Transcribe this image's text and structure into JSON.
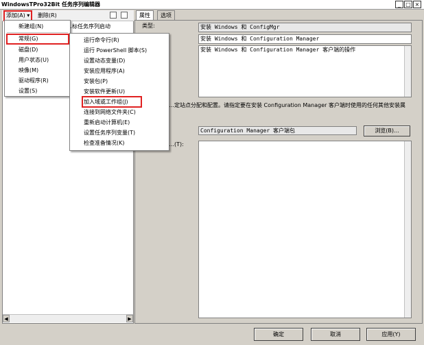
{
  "window": {
    "title": "WindowsTPro32Bit 任务序列编辑器",
    "controls": [
      "_",
      "□",
      "×"
    ]
  },
  "toolbar": {
    "add_label": "添加(A) ▾",
    "remove_label": "删除(R)"
  },
  "tree": {
    "partial_item": "…标任务序列启动"
  },
  "add_menu": {
    "items": [
      "新建组(N)",
      "常规(G)",
      "磁盘(D)",
      "用户状态(U)",
      "映像(M)",
      "驱动程序(R)",
      "设置(S)"
    ]
  },
  "general_submenu": {
    "items": [
      "运行命令行(R)",
      "运行 PowerShell 脚本(S)",
      "设置动态变量(D)",
      "安装应用程序(A)",
      "安装包(P)",
      "安装软件更新(U)",
      "加入域或工作组(J)",
      "连接到网络文件夹(C)",
      "重新启动计算机(E)",
      "设置任务序列变量(T)",
      "检查准备情况(K)"
    ]
  },
  "tabs": {
    "properties": "属性",
    "options": "选项"
  },
  "properties": {
    "type_label": "类型:",
    "type_value": "安装 Windows 和 ConfigMgr",
    "name_value": "安装 Windows 和 Configuration Manager",
    "description_value": "安装 Windows 和 Configuration Manager 客户端的操作",
    "instruction_text": "…定站点分配和配置。请指定要在安装 Configuration Manager 客户端时使用的任何其他安装属",
    "package_value": "Configuration Manager 客户端包",
    "browse_label": "浏览(B)...",
    "properties_label": "…(T):"
  },
  "footer": {
    "ok_label": "确定",
    "cancel_label": "取消",
    "apply_label": "应用(Y)"
  }
}
